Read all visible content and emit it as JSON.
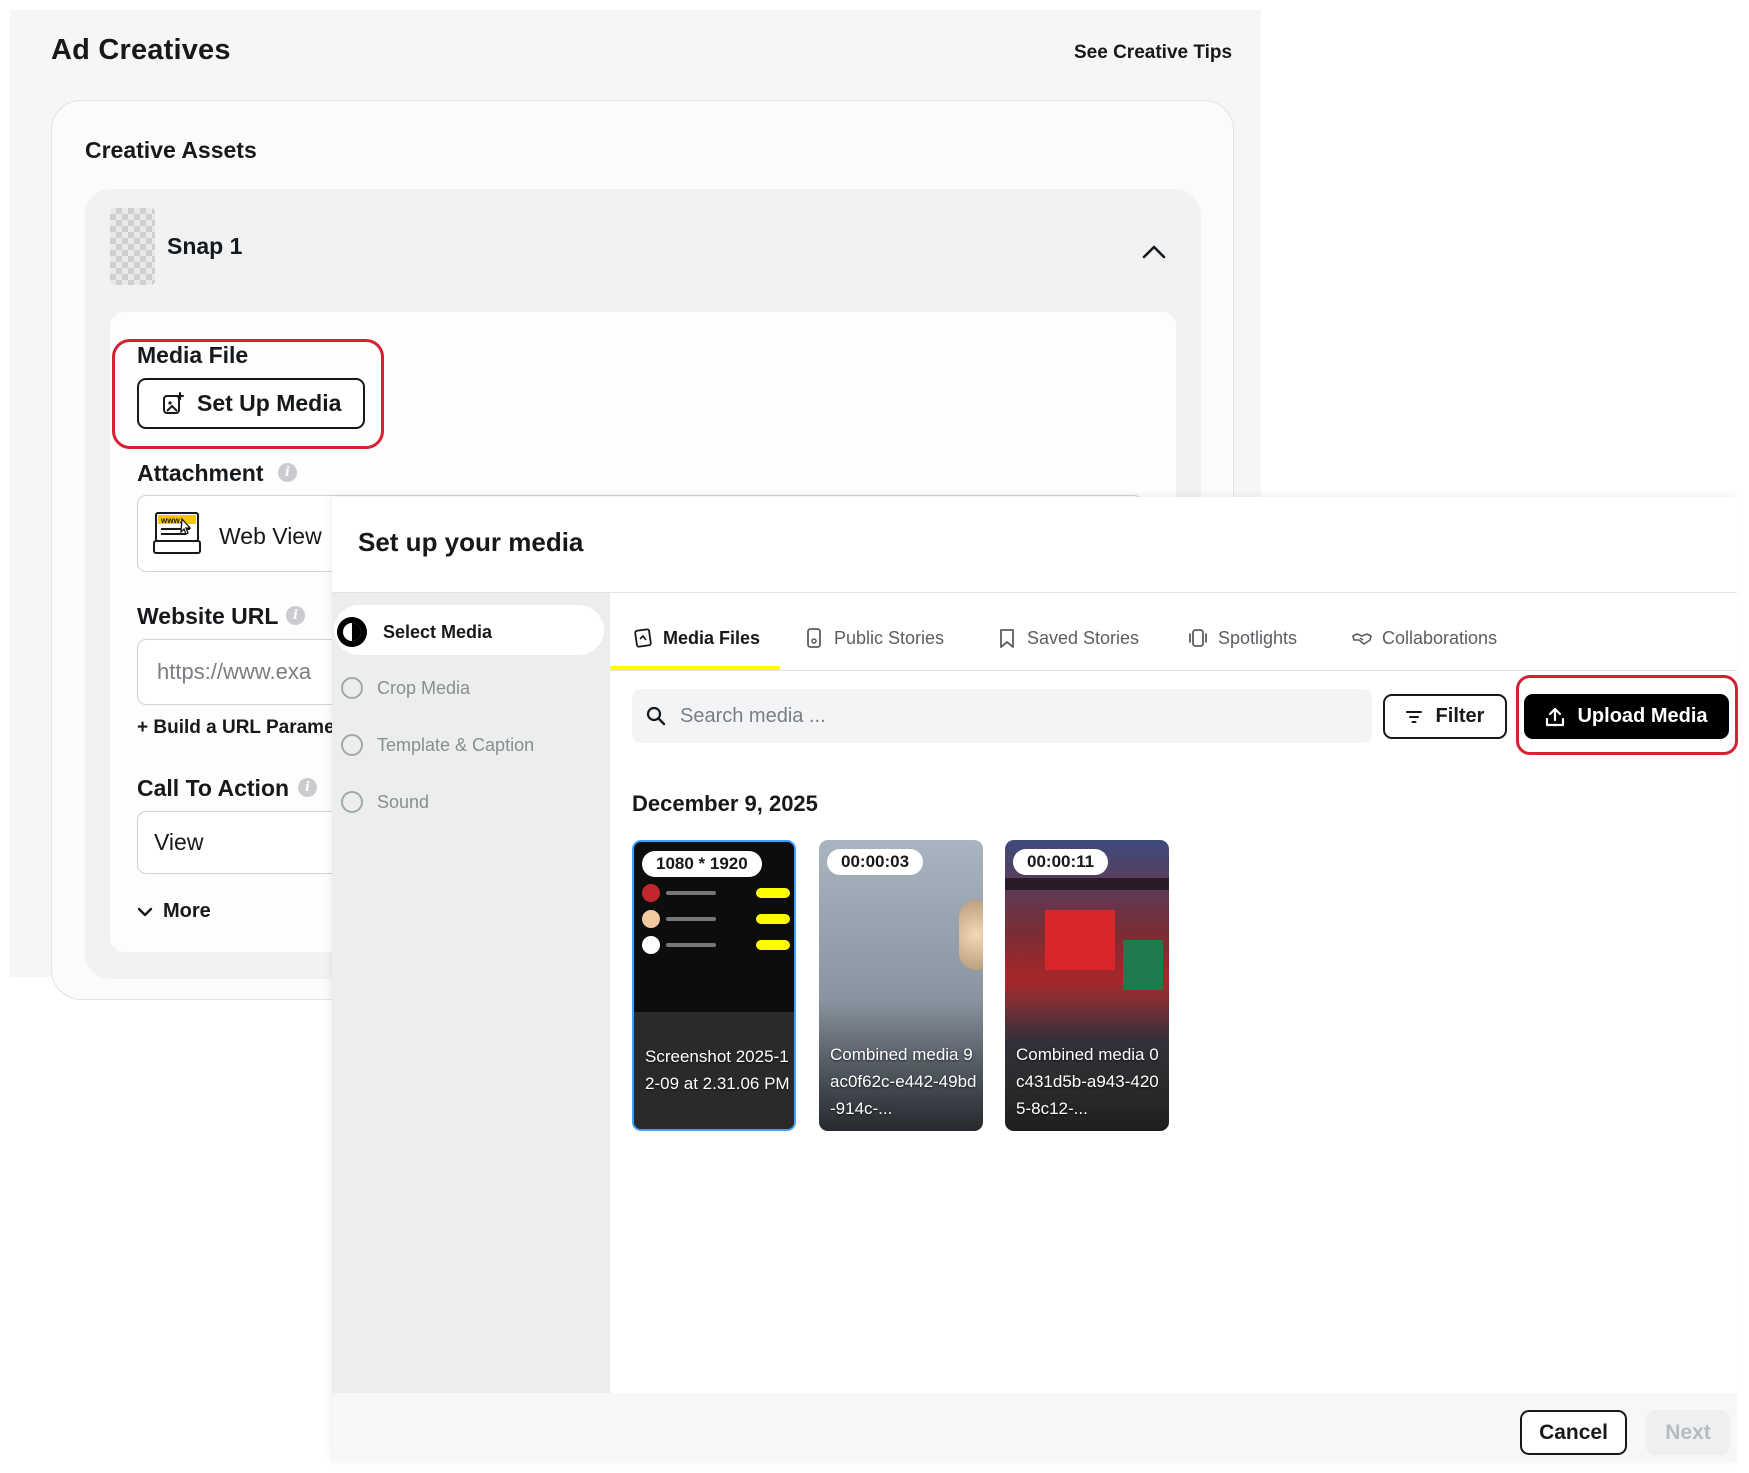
{
  "page": {
    "title": "Ad Creatives",
    "tips_link": "See Creative Tips"
  },
  "assets": {
    "title": "Creative Assets",
    "snap_label": "Snap 1",
    "media_file_label": "Media File",
    "setup_media_label": "Set Up Media",
    "attachment_label": "Attachment",
    "attachment_value": "Web View",
    "website_url_label": "Website URL",
    "website_url_placeholder": "https://www.exa",
    "url_param_link": "+ Build a URL Parame",
    "cta_label": "Call To Action",
    "cta_value": "View",
    "more_label": "More"
  },
  "modal": {
    "title": "Set up your media",
    "steps": [
      {
        "label": "Select Media",
        "active": true
      },
      {
        "label": "Crop Media",
        "active": false
      },
      {
        "label": "Template & Caption",
        "active": false
      },
      {
        "label": "Sound",
        "active": false
      }
    ],
    "tabs": [
      {
        "label": "Media Files",
        "icon": "media-files-icon",
        "active": true
      },
      {
        "label": "Public Stories",
        "icon": "phone-icon",
        "active": false
      },
      {
        "label": "Saved Stories",
        "icon": "bookmark-icon",
        "active": false
      },
      {
        "label": "Spotlights",
        "icon": "spotlight-icon",
        "active": false
      },
      {
        "label": "Collaborations",
        "icon": "handshake-icon",
        "active": false
      }
    ],
    "search_placeholder": "Search media ...",
    "filter_label": "Filter",
    "upload_label": "Upload Media",
    "date_heading": "December 9, 2025",
    "media": [
      {
        "chip": "1080 * 1920",
        "name": "Screenshot 2025-12-09 at 2.31.06 PM",
        "kind": "image"
      },
      {
        "chip": "00:00:03",
        "name": "Combined media 9ac0f62c-e442-49bd-914c-...",
        "kind": "video"
      },
      {
        "chip": "00:00:11",
        "name": "Combined media 0c431d5b-a943-4205-8c12-...",
        "kind": "video"
      }
    ],
    "cancel_label": "Cancel",
    "next_label": "Next"
  },
  "colors": {
    "highlight": "#d62033",
    "active_tab_underline": "#fffc00",
    "primary_button": "#000000"
  }
}
